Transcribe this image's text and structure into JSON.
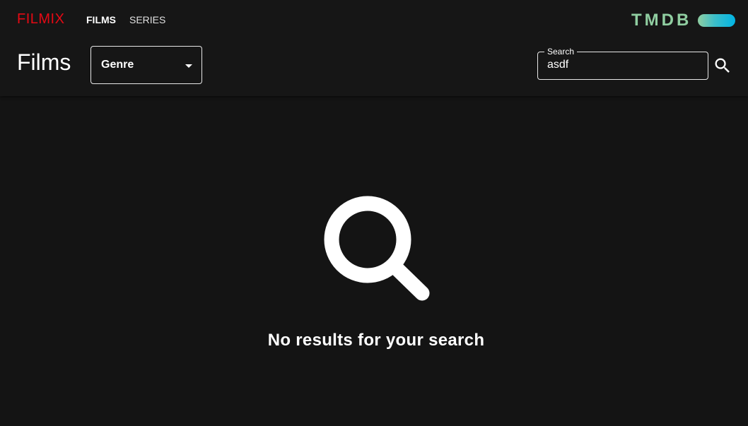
{
  "app": {
    "brand": "FILMIX",
    "brand_color": "#e50914"
  },
  "nav": {
    "items": [
      {
        "label": "FILMS",
        "active": true
      },
      {
        "label": "SERIES",
        "active": false
      }
    ]
  },
  "provider_logo": {
    "text": "TMDB",
    "icon": "tmdb-logo"
  },
  "page": {
    "title": "Films"
  },
  "filters": {
    "genre": {
      "selected": "Genre",
      "icon": "caret-down-icon"
    }
  },
  "search": {
    "label": "Search",
    "value": "asdf",
    "button_icon": "search-icon"
  },
  "empty_state": {
    "icon": "search-icon",
    "message": "No results for your search"
  }
}
